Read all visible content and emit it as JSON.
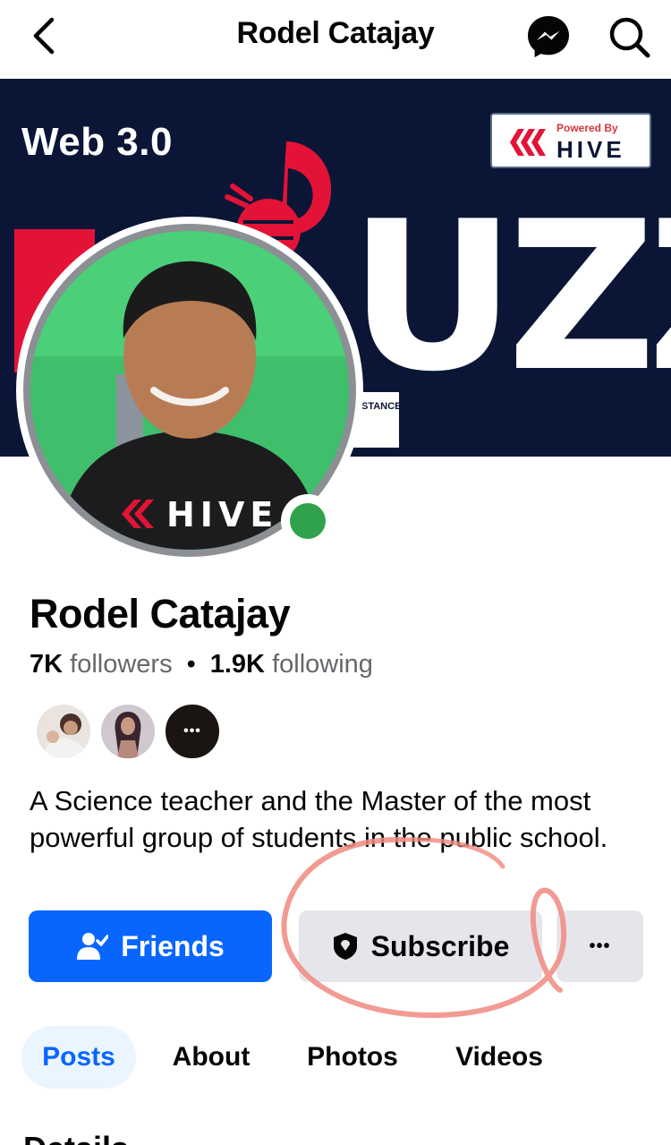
{
  "header": {
    "title": "Rodel Catajay",
    "back_icon": "chevron-left-icon",
    "messenger_icon": "messenger-icon",
    "search_icon": "search-icon"
  },
  "cover": {
    "headline": "Web 3.0",
    "badge_powered": "Powered By",
    "badge_brand": "HIVE",
    "big_text": "UZZ",
    "tag_text": "STANCE",
    "colors": {
      "background": "#0b1637",
      "accent": "#e31337"
    }
  },
  "avatar": {
    "shirt_text": "HIVE",
    "online": true,
    "online_color": "#31a24c"
  },
  "profile": {
    "name": "Rodel Catajay",
    "followers_count": "7K",
    "followers_label": "followers",
    "separator": "•",
    "following_count": "1.9K",
    "following_label": "following",
    "mutuals_more": "•••",
    "bio": "A Science teacher and the Master of the most powerful group of students in the public school."
  },
  "actions": {
    "friends_label": "Friends",
    "subscribe_label": "Subscribe",
    "more_label": "•••",
    "colors": {
      "primary": "#0866ff",
      "secondary": "#e4e6eb",
      "annotation": "#f08a80"
    }
  },
  "tabs": [
    {
      "label": "Posts",
      "active": true
    },
    {
      "label": "About",
      "active": false
    },
    {
      "label": "Photos",
      "active": false
    },
    {
      "label": "Videos",
      "active": false
    }
  ],
  "section_peek": "Details"
}
